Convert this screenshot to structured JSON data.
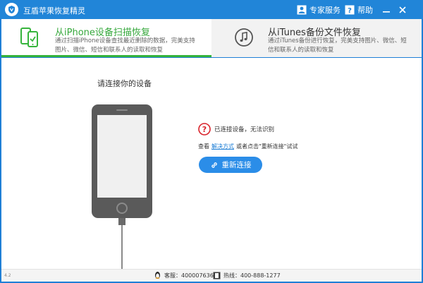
{
  "window": {
    "title": "互盾苹果恢复精灵",
    "expert_service": "专家服务",
    "help": "帮助",
    "minimize_glyph": "—",
    "close_glyph": "✕"
  },
  "tabs": [
    {
      "title": "从iPhone设备扫描恢复",
      "desc": "通过扫描iPhone设备查找最近删除的数据，完美支持图片、微信、短信和联系人的读取和恢复",
      "icon": "phone-scan-icon"
    },
    {
      "title": "从iTunes备份文件恢复",
      "desc": "通过iTunes备份进行恢复，完美支持图片、微信、短信和联系人的读取和恢复",
      "icon": "music-note-icon"
    }
  ],
  "main": {
    "connect_title": "请连接你的设备",
    "status_text": "已连接设备，无法识别",
    "hint_prefix": "查看",
    "hint_link": "解决方式",
    "hint_suffix": "或者点击\"重新连接\"试试",
    "reconnect_label": "重新连接"
  },
  "footer": {
    "version": "4.2",
    "qq": "客服：4000076365",
    "hotline": "热线：400-888-1277"
  },
  "colors": {
    "titlebar": "#2185d8",
    "accent_green": "#36b43c",
    "button_blue": "#2b8de8",
    "warning_red": "#d9232b"
  }
}
